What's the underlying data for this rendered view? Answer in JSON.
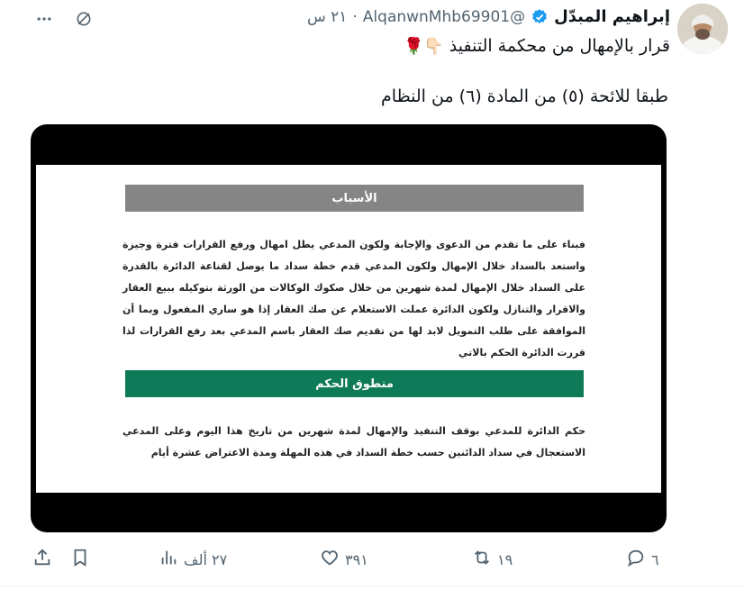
{
  "tweet": {
    "author_name": "إبراهيم المبدّل",
    "handle": "@AlqanwnMhb69901",
    "separator": "·",
    "time": "٢١ س",
    "line1": "قرار بالإمهال من محكمة التنفيذ",
    "line1_emojis": "👇🏻🌹",
    "line2": "طبقا للائحة (٥) من المادة (٦) من النظام"
  },
  "document": {
    "reasons_title": "الأسباب",
    "reasons_text": "فبناء على ما تقدم من الدعوى والإجابة ولكون المدعي يطل امهال ورفع القرارات فترة وجيزة واستعد بالسداد خلال الإمهال ولكون المدعي قدم خطة سداد ما يوصل لقناعة الدائرة بالقدرة على السداد خلال الإمهال لمدة شهرين من خلال صكوك الوكالات من الورثة بتوكيله ببيع العقار والاقرار والتنازل ولكون الدائرة عملت الاستعلام عن صك العقار إذا هو ساري المفعول وبما أن الموافقة على طلب التمويل لابد لها من تقديم صك العقار باسم المدعي بعد رفع القرارات لذا قررت الدائرة الحكم بالاتي",
    "verdict_title": "منطوق الحكم",
    "verdict_text": "حكم الدائرة للمدعي بوقف التنفيذ والإمهال لمدة شهرين من تاريخ هذا اليوم وعلى المدعي الاستعجال في سداد الدائنين حسب خطة السداد في هذه المهلة ومدة الاعتراض عشرة أيام"
  },
  "actions": {
    "replies": "٦",
    "retweets": "١٩",
    "likes": "٣٩١",
    "views": "٢٧ ألف"
  },
  "colors": {
    "accent": "#1d9bf0",
    "muted": "#536471",
    "reasons_bar": "#858585",
    "verdict_bar": "#0f7a57"
  },
  "icons": [
    "more-icon",
    "grok-icon",
    "verified-icon",
    "reply-icon",
    "retweet-icon",
    "like-icon",
    "views-icon",
    "bookmark-icon",
    "share-icon"
  ]
}
